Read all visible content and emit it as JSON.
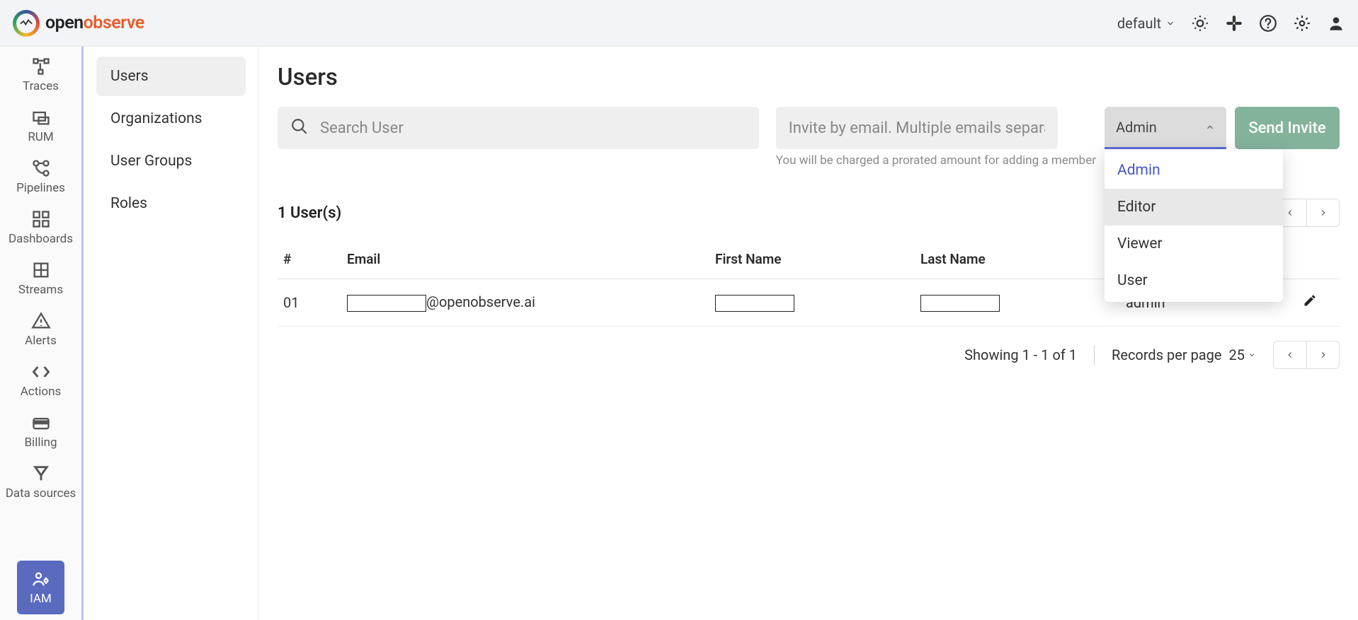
{
  "header": {
    "brand_open": "open",
    "brand_observe": "observe",
    "org_label": "default"
  },
  "leftnav": {
    "traces": "Traces",
    "rum": "RUM",
    "pipelines": "Pipelines",
    "dashboards": "Dashboards",
    "streams": "Streams",
    "alerts": "Alerts",
    "actions": "Actions",
    "billing": "Billing",
    "datasources": "Data sources",
    "iam": "IAM"
  },
  "subnav": {
    "users": "Users",
    "organizations": "Organizations",
    "user_groups": "User Groups",
    "roles": "Roles"
  },
  "page": {
    "title": "Users",
    "search_placeholder": "Search User",
    "invite_placeholder": "Invite by email. Multiple emails separated by comma",
    "role_selected": "Admin",
    "send_invite": "Send Invite",
    "charge_note": "You will be charged a prorated amount for adding a member",
    "user_count": "1 User(s)"
  },
  "role_options": [
    "Admin",
    "Editor",
    "Viewer",
    "User"
  ],
  "columns": {
    "idx": "#",
    "email": "Email",
    "first": "First Name",
    "last": "Last Name"
  },
  "rows": [
    {
      "idx": "01",
      "email_suffix": "@openobserve.ai",
      "role": "admin"
    }
  ],
  "footer": {
    "showing": "Showing 1 - 1 of 1",
    "rpp_label": "Records per page",
    "rpp_value": "25"
  }
}
